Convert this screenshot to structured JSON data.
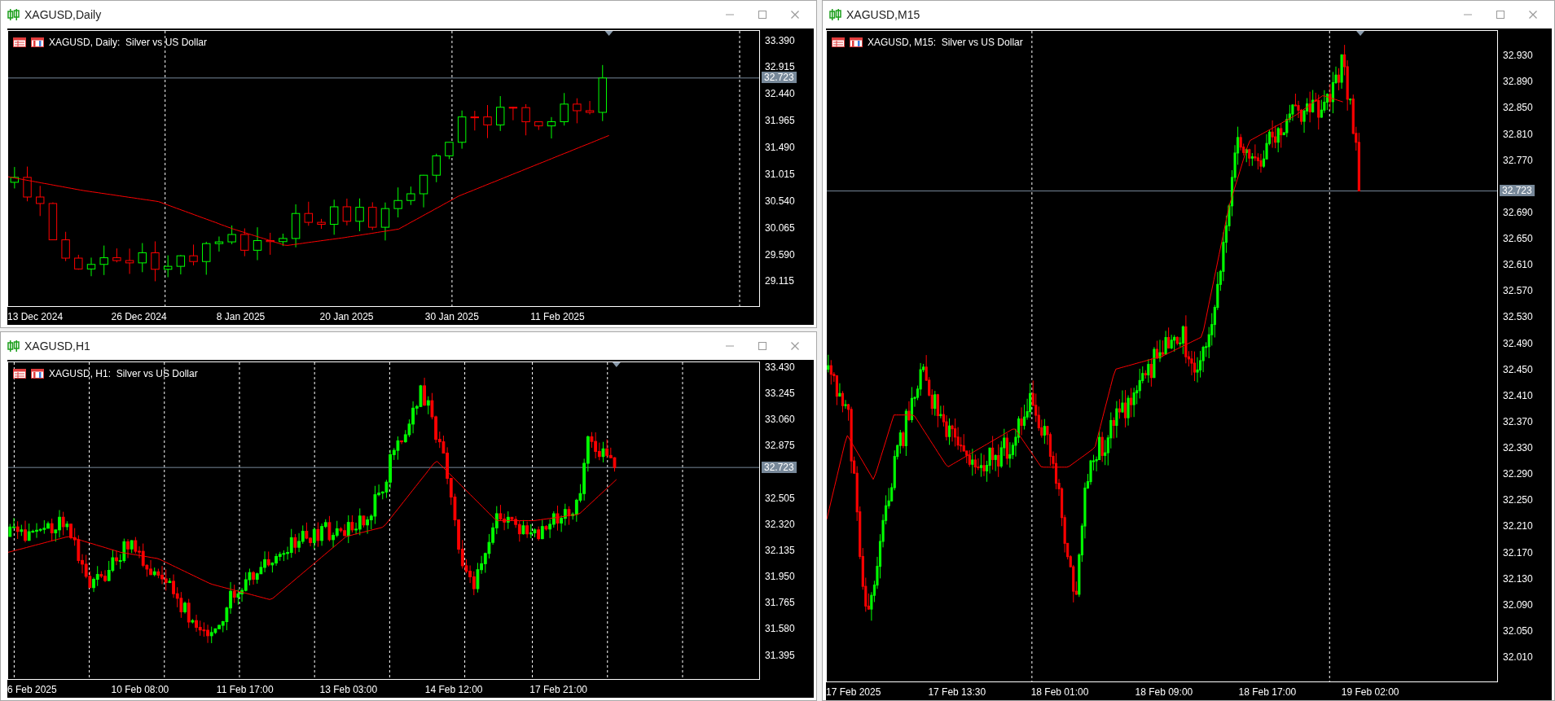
{
  "windows": [
    {
      "title": "XAGUSD,Daily",
      "legend": "XAGUSD, Daily:  Silver vs US Dollar",
      "price_labels": [
        "33.390",
        "32.915",
        "32.440",
        "31.965",
        "31.490",
        "31.015",
        "30.540",
        "30.065",
        "29.590",
        "29.115"
      ],
      "current_price": "32.723",
      "time_labels": [
        "13 Dec 2024",
        "26 Dec 2024",
        "8 Jan 2025",
        "20 Jan 2025",
        "30 Jan 2025",
        "11 Feb 2025"
      ]
    },
    {
      "title": "XAGUSD,H1",
      "legend": "XAGUSD, H1:  Silver vs US Dollar",
      "price_labels": [
        "33.430",
        "33.245",
        "33.060",
        "32.875",
        "32.505",
        "32.320",
        "32.135",
        "31.950",
        "31.765",
        "31.580",
        "31.395"
      ],
      "current_price": "32.723",
      "time_labels": [
        "6 Feb 2025",
        "10 Feb 08:00",
        "11 Feb 17:00",
        "13 Feb 03:00",
        "14 Feb 12:00",
        "17 Feb 21:00"
      ]
    },
    {
      "title": "XAGUSD,M15",
      "legend": "XAGUSD, M15:  Silver vs US Dollar",
      "price_labels": [
        "32.930",
        "32.890",
        "32.850",
        "32.810",
        "32.770",
        "32.690",
        "32.650",
        "32.610",
        "32.570",
        "32.530",
        "32.490",
        "32.450",
        "32.410",
        "32.370",
        "32.330",
        "32.290",
        "32.250",
        "32.210",
        "32.170",
        "32.130",
        "32.090",
        "32.050",
        "32.010"
      ],
      "current_price": "32.723",
      "time_labels": [
        "17 Feb 2025",
        "17 Feb 13:30",
        "18 Feb 01:00",
        "18 Feb 09:00",
        "18 Feb 17:00",
        "19 Feb 02:00"
      ]
    }
  ]
}
